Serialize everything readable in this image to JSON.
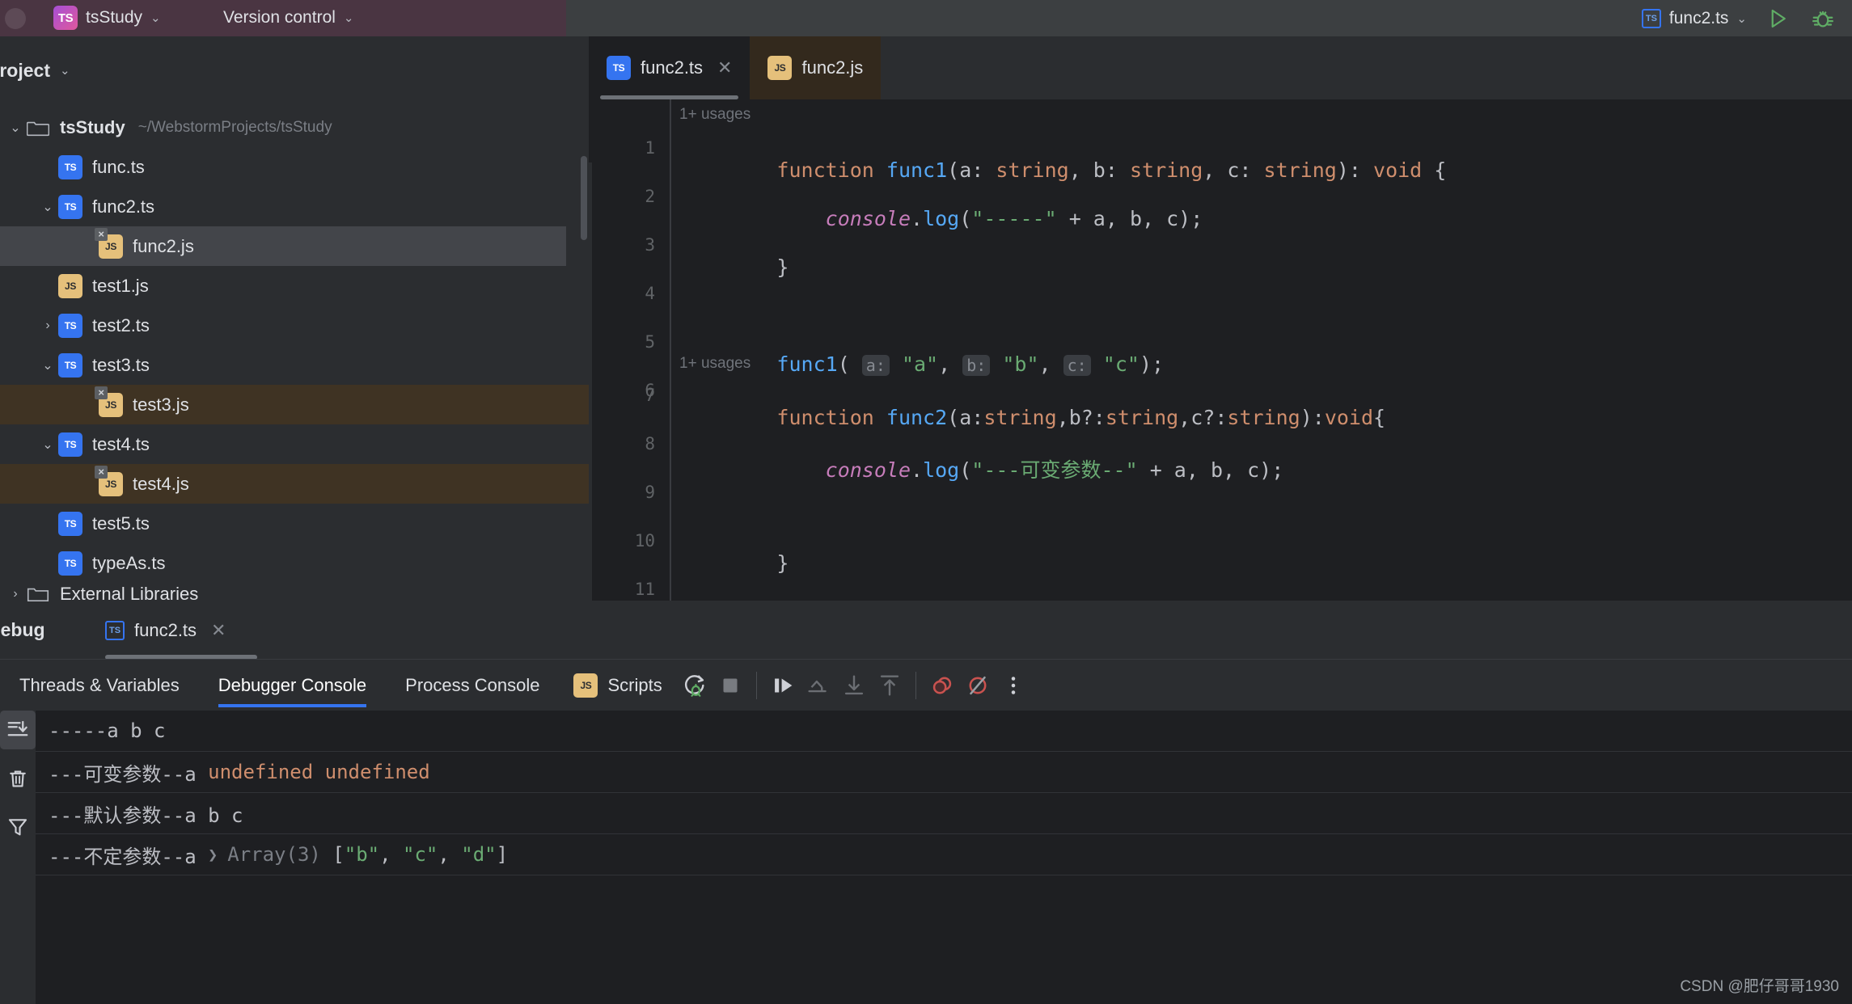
{
  "titlebar": {
    "project_badge": "TS",
    "project_name": "tsStudy",
    "vcs_label": "Version control",
    "run_config_badge": "TS",
    "run_config_name": "func2.ts",
    "run_icon": "play-icon",
    "debug_icon": "bug-icon",
    "chevron": "⌄"
  },
  "sidebar": {
    "title": "Project",
    "chevron": "⌄",
    "tree": [
      {
        "name": "tsStudy",
        "path": "~/WebstormProjects/tsStudy",
        "icon": "folder",
        "arrow": "⌄",
        "indent": 0,
        "bold": true,
        "state": "none"
      },
      {
        "name": "func.ts",
        "path": "",
        "icon": "ts",
        "arrow": "",
        "indent": 1,
        "bold": false,
        "state": "none"
      },
      {
        "name": "func2.ts",
        "path": "",
        "icon": "ts",
        "arrow": "⌄",
        "indent": 1,
        "bold": false,
        "state": "none"
      },
      {
        "name": "func2.js",
        "path": "",
        "icon": "js-x",
        "arrow": "",
        "indent": 2,
        "bold": false,
        "state": "selected-grey"
      },
      {
        "name": "test1.js",
        "path": "",
        "icon": "js",
        "arrow": "",
        "indent": 1,
        "bold": false,
        "state": "none"
      },
      {
        "name": "test2.ts",
        "path": "",
        "icon": "ts",
        "arrow": "›",
        "indent": 1,
        "bold": false,
        "state": "none"
      },
      {
        "name": "test3.ts",
        "path": "",
        "icon": "ts",
        "arrow": "⌄",
        "indent": 1,
        "bold": false,
        "state": "none"
      },
      {
        "name": "test3.js",
        "path": "",
        "icon": "js-x",
        "arrow": "",
        "indent": 2,
        "bold": false,
        "state": "selected-brown"
      },
      {
        "name": "test4.ts",
        "path": "",
        "icon": "ts",
        "arrow": "⌄",
        "indent": 1,
        "bold": false,
        "state": "none"
      },
      {
        "name": "test4.js",
        "path": "",
        "icon": "js-x",
        "arrow": "",
        "indent": 2,
        "bold": false,
        "state": "selected-brown"
      },
      {
        "name": "test5.ts",
        "path": "",
        "icon": "ts",
        "arrow": "",
        "indent": 1,
        "bold": false,
        "state": "none"
      },
      {
        "name": "typeAs.ts",
        "path": "",
        "icon": "ts",
        "arrow": "",
        "indent": 1,
        "bold": false,
        "state": "none"
      },
      {
        "name": "External Libraries",
        "path": "",
        "icon": "lib",
        "arrow": "›",
        "indent": 0,
        "bold": false,
        "state": "clipped"
      }
    ]
  },
  "editor": {
    "tabs": [
      {
        "label": "func2.ts",
        "icon": "ts",
        "active": true,
        "closable": true
      },
      {
        "label": "func2.js",
        "icon": "js",
        "active": false,
        "closable": false
      }
    ],
    "close_glyph": "✕",
    "usages_label": "1+ usages",
    "gutter": [
      "1",
      "2",
      "3",
      "4",
      "5",
      "6",
      "7",
      "8",
      "9",
      "10",
      "11"
    ],
    "code": {
      "l1_kw_function": "function",
      "l1_name": "func1",
      "l1_open": "(a: ",
      "l1_t1": "string",
      "l1_mid1": ", b: ",
      "l1_t2": "string",
      "l1_mid2": ", c: ",
      "l1_t3": "string",
      "l1_close": "): ",
      "l1_void": "void",
      "l1_brace": " {",
      "l2_indent": "    ",
      "l2_console": "console",
      "l2_dot": ".",
      "l2_log": "log",
      "l2_paren": "(",
      "l2_str": "\"-----\"",
      "l2_rest": " + a, b, c);",
      "l3": "}",
      "l5_name": "func1",
      "l5_open": "( ",
      "l5_h1": "a:",
      "l5_v1": " \"a\"",
      "l5_c1": ", ",
      "l5_h2": "b:",
      "l5_v2": " \"b\"",
      "l5_c2": ", ",
      "l5_h3": "c:",
      "l5_v3": " \"c\"",
      "l5_end": ");",
      "l7_kw_function": "function",
      "l7_name": "func2",
      "l7_open": "(a:",
      "l7_t1": "string",
      "l7_mid1": ",b?:",
      "l7_t2": "string",
      "l7_mid2": ",c?:",
      "l7_t3": "string",
      "l7_close": "):",
      "l7_void": "void",
      "l7_brace": "{",
      "l8_indent": "    ",
      "l8_console": "console",
      "l8_dot": ".",
      "l8_log": "log",
      "l8_paren": "(",
      "l8_str": "\"---可变参数--\"",
      "l8_rest": " + a, b, c);",
      "l10": "}"
    }
  },
  "debug": {
    "title": "Debug",
    "session_tab": "func2.ts",
    "session_icon": "ts",
    "close_glyph": "✕",
    "tabs": [
      {
        "label": "Threads & Variables",
        "active": false
      },
      {
        "label": "Debugger Console",
        "active": true
      },
      {
        "label": "Process Console",
        "active": false
      }
    ],
    "scripts_label": "Scripts",
    "scripts_icon": "js",
    "toolbar_icons": [
      "rerun-debug-icon",
      "stop-icon",
      "resume-program-icon",
      "step-over-icon",
      "step-into-icon",
      "step-out-icon",
      "view-breakpoints-icon",
      "mute-breakpoints-icon",
      "more-options-icon"
    ],
    "rail_icons": [
      "scroll-to-end-icon",
      "clear-all-icon",
      "filter-icon"
    ],
    "console_lines": [
      {
        "segments": [
          {
            "text": "-----a b c",
            "style": "plain"
          }
        ]
      },
      {
        "segments": [
          {
            "text": "---可变参数--a ",
            "style": "plain"
          },
          {
            "text": "undefined undefined",
            "style": "undefined"
          }
        ]
      },
      {
        "segments": [
          {
            "text": "---默认参数--a b c",
            "style": "plain"
          }
        ]
      },
      {
        "segments": [
          {
            "text": "---不定参数--a ",
            "style": "plain"
          },
          {
            "text": "❯ ",
            "style": "arrow"
          },
          {
            "text": "Array(3) ",
            "style": "grey"
          },
          {
            "text": "[",
            "style": "plain"
          },
          {
            "text": "\"b\"",
            "style": "string"
          },
          {
            "text": ", ",
            "style": "plain"
          },
          {
            "text": "\"c\"",
            "style": "string"
          },
          {
            "text": ", ",
            "style": "plain"
          },
          {
            "text": "\"d\"",
            "style": "string"
          },
          {
            "text": "]",
            "style": "plain"
          }
        ]
      }
    ]
  },
  "watermark": "CSDN @肥仔哥哥1930",
  "colors": {
    "accent_blue": "#3574f0",
    "ts_badge": "#3574f0",
    "js_badge": "#e5c07b",
    "keyword": "#cf8e6d",
    "string": "#6aab73",
    "function": "#56a8f5",
    "field": "#c77dbb",
    "editor_bg": "#1e1f22",
    "panel_bg": "#2b2d30",
    "selection_grey": "#43454a",
    "selection_brown": "#3f3323"
  }
}
